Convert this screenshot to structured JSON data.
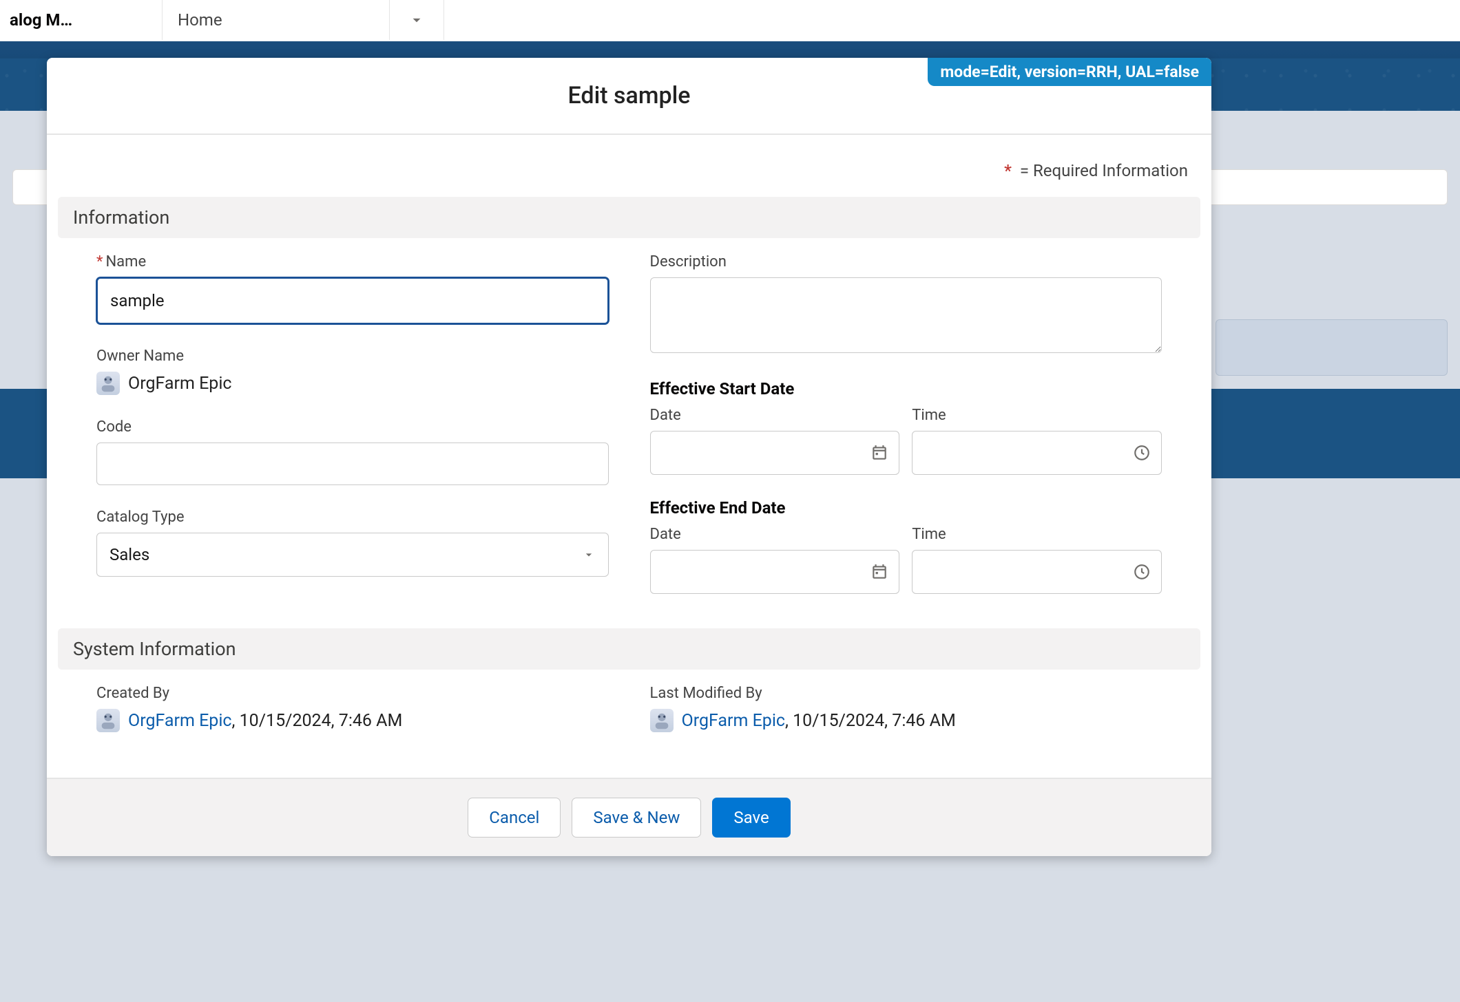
{
  "app": {
    "name_truncated": "alog M…",
    "tab_home": "Home"
  },
  "modal": {
    "title": "Edit sample",
    "mode_badge": "mode=Edit, version=RRH, UAL=false",
    "required_note": " = Required Information"
  },
  "sections": {
    "information": "Information",
    "system_information": "System Information"
  },
  "fields": {
    "name": {
      "label": "Name",
      "value": "sample"
    },
    "description": {
      "label": "Description",
      "value": ""
    },
    "owner_name": {
      "label": "Owner Name",
      "value": "OrgFarm Epic"
    },
    "effective_start": {
      "label": "Effective Start Date",
      "date_label": "Date",
      "time_label": "Time",
      "date_value": "",
      "time_value": ""
    },
    "code": {
      "label": "Code",
      "value": ""
    },
    "effective_end": {
      "label": "Effective End Date",
      "date_label": "Date",
      "time_label": "Time",
      "date_value": "",
      "time_value": ""
    },
    "catalog_type": {
      "label": "Catalog Type",
      "value": "Sales"
    },
    "created_by": {
      "label": "Created By",
      "user": "OrgFarm Epic",
      "timestamp": ", 10/15/2024, 7:46 AM"
    },
    "last_modified_by": {
      "label": "Last Modified By",
      "user": "OrgFarm Epic",
      "timestamp": ", 10/15/2024, 7:46 AM"
    }
  },
  "buttons": {
    "cancel": "Cancel",
    "save_new": "Save & New",
    "save": "Save"
  }
}
